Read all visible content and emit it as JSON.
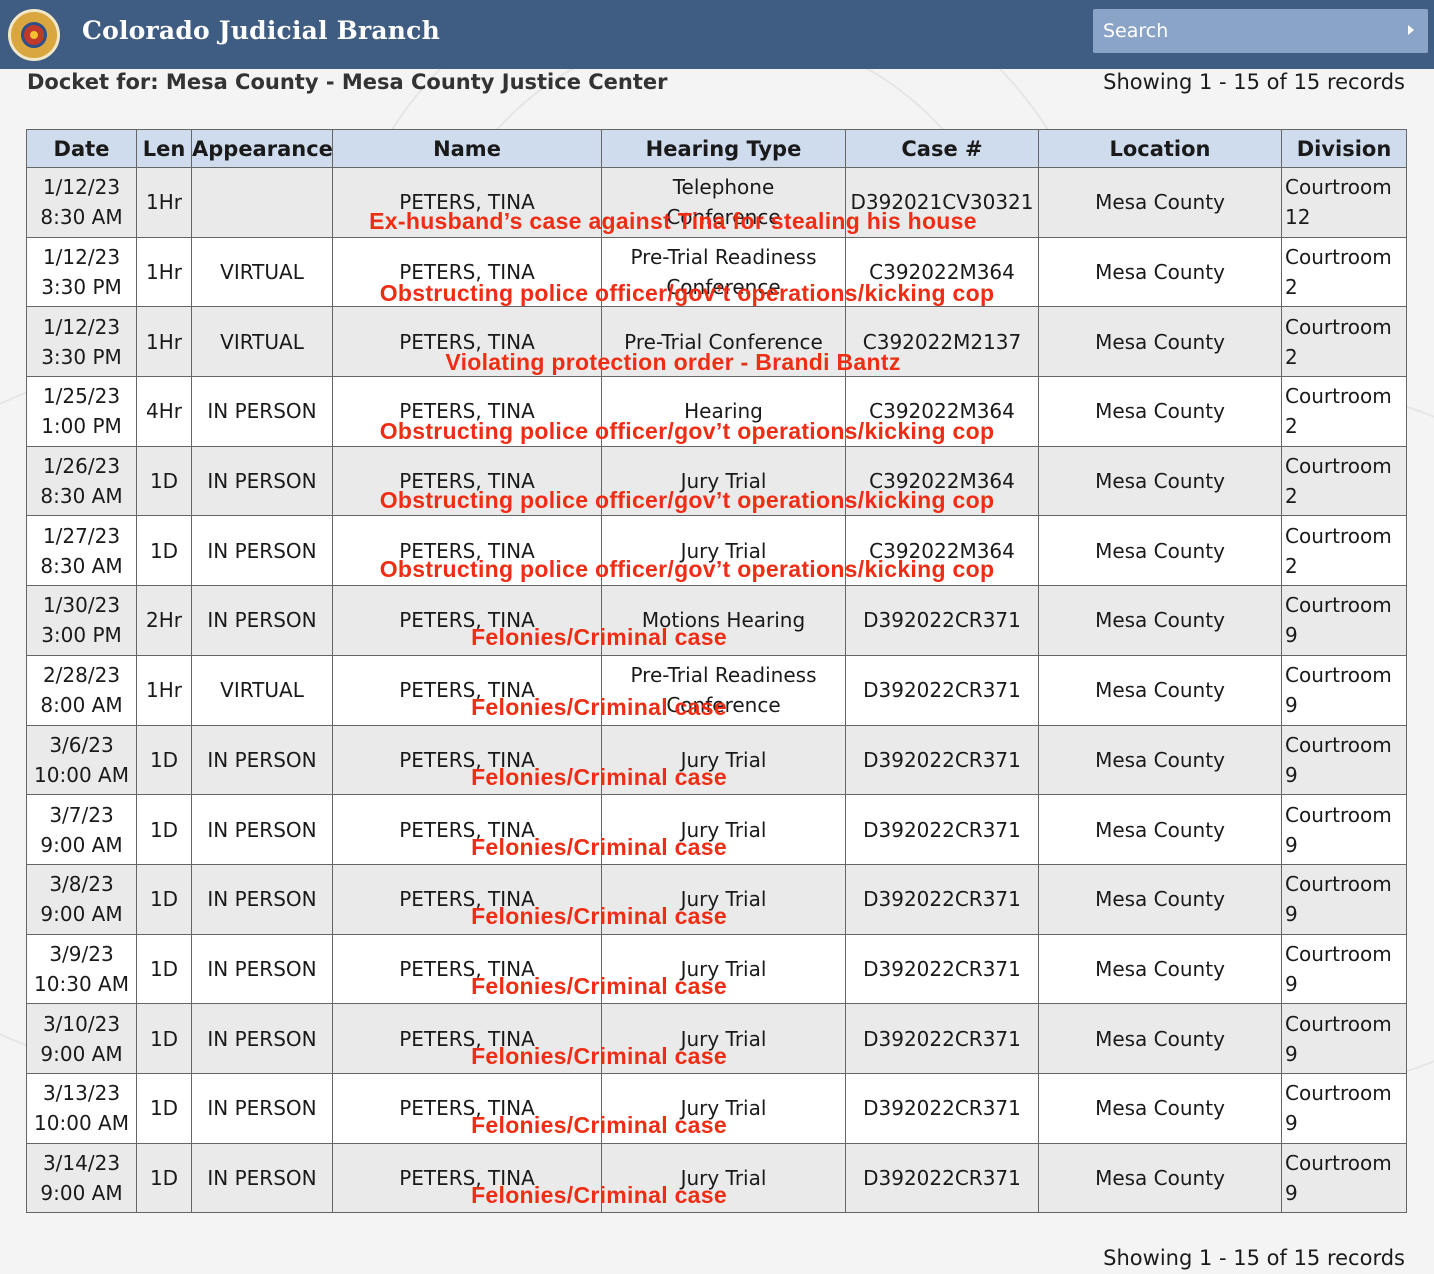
{
  "header": {
    "brand": "Colorado Judicial Branch",
    "search_placeholder": "Search",
    "seal_icon": "colorado-courts-seal-icon",
    "colors": {
      "header_bg": "#3f5c82",
      "search_bg": "#8aa4c8",
      "annotation": "#ef2d14",
      "table_header_bg": "#cfdcee"
    }
  },
  "docket": {
    "title": "Docket for: Mesa County - Mesa County Justice Center",
    "records_top": "Showing 1 - 15 of 15 records",
    "records_bottom": "Showing 1 - 15 of 15 records"
  },
  "table": {
    "columns": [
      "Date",
      "Len",
      "Appearance",
      "Name",
      "Hearing Type",
      "Case #",
      "Location",
      "Division"
    ],
    "rows": [
      {
        "date": "1/12/23",
        "time": "8:30 AM",
        "len": "1Hr",
        "appearance": "",
        "name": "PETERS, TINA",
        "hearing_line1": "Telephone",
        "hearing_line2": "Conference",
        "case": "D392021CV30321",
        "location": "Mesa County",
        "division_line1": "Courtroom",
        "division_line2": "12"
      },
      {
        "date": "1/12/23",
        "time": "3:30 PM",
        "len": "1Hr",
        "appearance": "VIRTUAL",
        "name": "PETERS, TINA",
        "hearing_line1": "Pre-Trial Readiness",
        "hearing_line2": "Conference",
        "case": "C392022M364",
        "location": "Mesa County",
        "division_line1": "Courtroom",
        "division_line2": "2"
      },
      {
        "date": "1/12/23",
        "time": "3:30 PM",
        "len": "1Hr",
        "appearance": "VIRTUAL",
        "name": "PETERS, TINA",
        "hearing_line1": "Pre-Trial Conference",
        "hearing_line2": "",
        "case": "C392022M2137",
        "location": "Mesa County",
        "division_line1": "Courtroom",
        "division_line2": "2"
      },
      {
        "date": "1/25/23",
        "time": "1:00 PM",
        "len": "4Hr",
        "appearance": "IN PERSON",
        "name": "PETERS, TINA",
        "hearing_line1": "Hearing",
        "hearing_line2": "",
        "case": "C392022M364",
        "location": "Mesa County",
        "division_line1": "Courtroom",
        "division_line2": "2"
      },
      {
        "date": "1/26/23",
        "time": "8:30 AM",
        "len": "1D",
        "appearance": "IN PERSON",
        "name": "PETERS, TINA",
        "hearing_line1": "Jury Trial",
        "hearing_line2": "",
        "case": "C392022M364",
        "location": "Mesa County",
        "division_line1": "Courtroom",
        "division_line2": "2"
      },
      {
        "date": "1/27/23",
        "time": "8:30 AM",
        "len": "1D",
        "appearance": "IN PERSON",
        "name": "PETERS, TINA",
        "hearing_line1": "Jury Trial",
        "hearing_line2": "",
        "case": "C392022M364",
        "location": "Mesa County",
        "division_line1": "Courtroom",
        "division_line2": "2"
      },
      {
        "date": "1/30/23",
        "time": "3:00 PM",
        "len": "2Hr",
        "appearance": "IN PERSON",
        "name": "PETERS, TINA",
        "hearing_line1": "Motions Hearing",
        "hearing_line2": "",
        "case": "D392022CR371",
        "location": "Mesa County",
        "division_line1": "Courtroom",
        "division_line2": "9"
      },
      {
        "date": "2/28/23",
        "time": "8:00 AM",
        "len": "1Hr",
        "appearance": "VIRTUAL",
        "name": "PETERS, TINA",
        "hearing_line1": "Pre-Trial Readiness",
        "hearing_line2": "Conference",
        "case": "D392022CR371",
        "location": "Mesa County",
        "division_line1": "Courtroom",
        "division_line2": "9"
      },
      {
        "date": "3/6/23",
        "time": "10:00 AM",
        "len": "1D",
        "appearance": "IN PERSON",
        "name": "PETERS, TINA",
        "hearing_line1": "Jury Trial",
        "hearing_line2": "",
        "case": "D392022CR371",
        "location": "Mesa County",
        "division_line1": "Courtroom",
        "division_line2": "9"
      },
      {
        "date": "3/7/23",
        "time": "9:00 AM",
        "len": "1D",
        "appearance": "IN PERSON",
        "name": "PETERS, TINA",
        "hearing_line1": "Jury Trial",
        "hearing_line2": "",
        "case": "D392022CR371",
        "location": "Mesa County",
        "division_line1": "Courtroom",
        "division_line2": "9"
      },
      {
        "date": "3/8/23",
        "time": "9:00 AM",
        "len": "1D",
        "appearance": "IN PERSON",
        "name": "PETERS, TINA",
        "hearing_line1": "Jury Trial",
        "hearing_line2": "",
        "case": "D392022CR371",
        "location": "Mesa County",
        "division_line1": "Courtroom",
        "division_line2": "9"
      },
      {
        "date": "3/9/23",
        "time": "10:30 AM",
        "len": "1D",
        "appearance": "IN PERSON",
        "name": "PETERS, TINA",
        "hearing_line1": "Jury Trial",
        "hearing_line2": "",
        "case": "D392022CR371",
        "location": "Mesa County",
        "division_line1": "Courtroom",
        "division_line2": "9"
      },
      {
        "date": "3/10/23",
        "time": "9:00 AM",
        "len": "1D",
        "appearance": "IN PERSON",
        "name": "PETERS, TINA",
        "hearing_line1": "Jury Trial",
        "hearing_line2": "",
        "case": "D392022CR371",
        "location": "Mesa County",
        "division_line1": "Courtroom",
        "division_line2": "9"
      },
      {
        "date": "3/13/23",
        "time": "10:00 AM",
        "len": "1D",
        "appearance": "IN PERSON",
        "name": "PETERS, TINA",
        "hearing_line1": "Jury Trial",
        "hearing_line2": "",
        "case": "D392022CR371",
        "location": "Mesa County",
        "division_line1": "Courtroom",
        "division_line2": "9"
      },
      {
        "date": "3/14/23",
        "time": "9:00 AM",
        "len": "1D",
        "appearance": "IN PERSON",
        "name": "PETERS, TINA",
        "hearing_line1": "Jury Trial",
        "hearing_line2": "",
        "case": "D392022CR371",
        "location": "Mesa County",
        "division_line1": "Courtroom",
        "division_line2": "9"
      }
    ]
  },
  "annotations": [
    "Ex-husband’s case against Tina for stealing his house",
    "Obstructing police officer/gov’t operations/kicking cop",
    "Violating protection order - Brandi Bantz",
    "Obstructing police officer/gov’t operations/kicking cop",
    "Obstructing police officer/gov’t operations/kicking cop",
    "Obstructing police officer/gov’t operations/kicking cop",
    "Felonies/Criminal case",
    "Felonies/Criminal case",
    "Felonies/Criminal case",
    "Felonies/Criminal case",
    "Felonies/Criminal case",
    "Felonies/Criminal case",
    "Felonies/Criminal case",
    "Felonies/Criminal case",
    "Felonies/Criminal case"
  ]
}
